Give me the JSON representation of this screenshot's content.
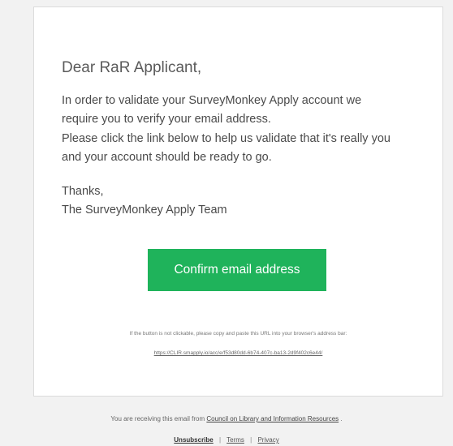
{
  "email": {
    "greeting": "Dear RaR Applicant,",
    "body_lines": [
      "In order to validate your SurveyMonkey Apply account we",
      "require you to verify your email address.",
      "Please click the link below to help us validate that it's really you",
      "and your account should be ready to go."
    ],
    "signoff": "Thanks,",
    "signature": "The SurveyMonkey Apply Team",
    "confirm_label": "Confirm email address",
    "url_note": "If the button is not clickable, please copy and paste this URL into your browser's address bar:",
    "url": "https://CLIR.smapply.io/acc/e/f53d80dd-6b74-407c-ba13-2d9f402c6e44/"
  },
  "footer": {
    "receiving_prefix": "You are receiving this email from",
    "org_link": "Council on Library and Information Resources",
    "receiving_suffix": ".",
    "unsubscribe": "Unsubscribe",
    "separator": "|",
    "terms": "Terms",
    "privacy": "Privacy"
  },
  "colors": {
    "button": "#1fb35b",
    "background": "#f2f2f2",
    "card": "#ffffff"
  }
}
